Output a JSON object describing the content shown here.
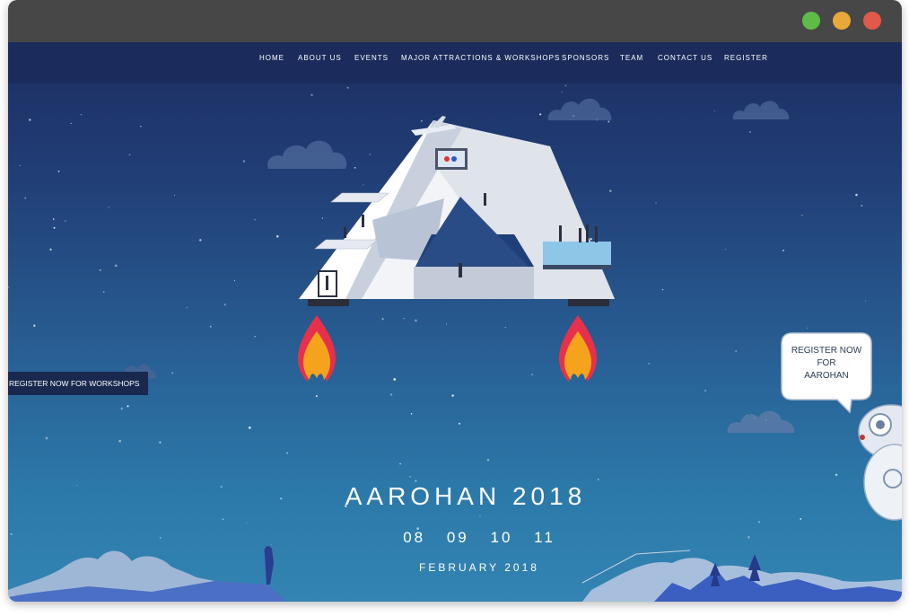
{
  "nav": {
    "items": [
      {
        "label": "HOME"
      },
      {
        "label": "ABOUT US"
      },
      {
        "label": "EVENTS"
      },
      {
        "label": "MAJOR ATTRACTIONS & WORKSHOPS"
      },
      {
        "label": "SPONSORS"
      },
      {
        "label": "TEAM"
      },
      {
        "label": "CONTACT US"
      },
      {
        "label": "REGISTER"
      }
    ]
  },
  "workshop_tab": {
    "label": "REGISTER NOW FOR WORKSHOPS"
  },
  "bubble": {
    "line1": "REGISTER NOW",
    "line2": "FOR",
    "line3": "AAROHAN"
  },
  "hero": {
    "title": "AAROHAN 2018",
    "dates": [
      "08",
      "09",
      "10",
      "11"
    ],
    "month": "FEBRUARY 2018"
  },
  "colors": {
    "titlebar": "#474747",
    "nav_bg": "#1b2c5c",
    "sky_top": "#1c2e62",
    "sky_bottom": "#3384b3",
    "flame_red": "#e8304a",
    "flame_orange": "#f5a31c",
    "window_green": "#5dbb46",
    "window_yellow": "#e8a93a",
    "window_red": "#e0594b"
  }
}
